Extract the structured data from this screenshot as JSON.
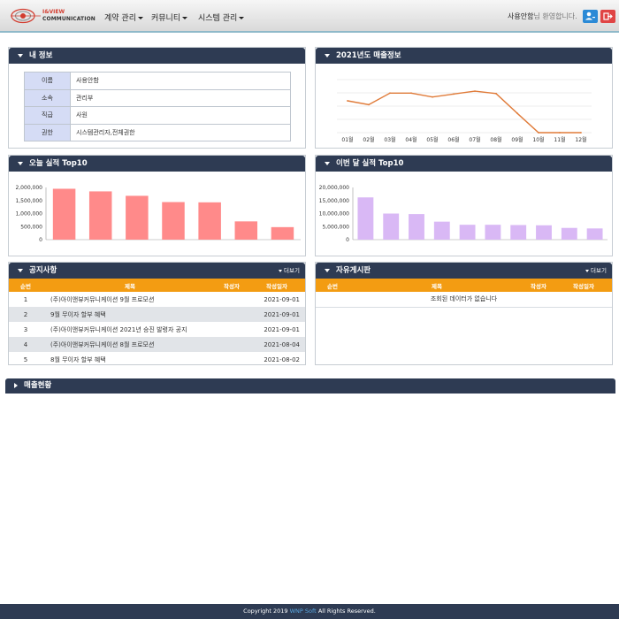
{
  "header": {
    "logo_line1": "I&VIEW",
    "logo_line2": "COMMUNICATION",
    "menus": [
      "계약 관리",
      "커뮤니티",
      "시스템 관리"
    ],
    "user_name": "사용안함",
    "greeting_suffix": "님 환영합니다."
  },
  "my_info": {
    "title": "내 정보",
    "rows": [
      {
        "key": "이름",
        "value": "사용안함"
      },
      {
        "key": "소속",
        "value": "관리부"
      },
      {
        "key": "직급",
        "value": "사원"
      },
      {
        "key": "권한",
        "value": "시스템관리자,전체권한"
      }
    ]
  },
  "sales_panel": {
    "title": "2021년도 매출정보"
  },
  "today_panel": {
    "title": "오늘 실적 Top10"
  },
  "month_panel": {
    "title": "이번 달 실적 Top10"
  },
  "notice": {
    "title": "공지사항",
    "more": "더보기",
    "columns": [
      "순번",
      "제목",
      "작성자",
      "작성일자"
    ],
    "rows": [
      {
        "no": "1",
        "title": "(주)아이앤뷰커뮤니케이션 9월 프로모션",
        "author": "",
        "date": "2021-09-01"
      },
      {
        "no": "2",
        "title": "9월 무이자 할부 혜택",
        "author": "",
        "date": "2021-09-01"
      },
      {
        "no": "3",
        "title": "(주)아이앤뷰커뮤니케이션 2021년 승진 발령자 공지",
        "author": "",
        "date": "2021-09-01"
      },
      {
        "no": "4",
        "title": "(주)아이앤뷰커뮤니케이션 8월 프로모션",
        "author": "",
        "date": "2021-08-04"
      },
      {
        "no": "5",
        "title": "8월 무이자 할부 혜택",
        "author": "",
        "date": "2021-08-02"
      }
    ]
  },
  "free_board": {
    "title": "자유게시판",
    "more": "더보기",
    "columns": [
      "순번",
      "제목",
      "작성자",
      "작성일자"
    ],
    "empty_text": "조회된 데이터가 없습니다"
  },
  "sales_status": {
    "title": "매출현황"
  },
  "footer": {
    "copyright": "Copyright 2019",
    "brand": "WNP Soft",
    "rights": "All Rights Reserved."
  },
  "colors": {
    "nav": "#2e3b53",
    "line": "#e07b39",
    "today_bar": "#ff8a8a",
    "month_bar": "#d9b8f5",
    "board_head": "#f39c12",
    "info_key": "#d5dcf5"
  },
  "chart_data": [
    {
      "type": "line",
      "categories": [
        "01월",
        "02월",
        "03월",
        "04월",
        "05월",
        "06월",
        "07월",
        "08월",
        "09월",
        "10월",
        "11월",
        "12월"
      ],
      "values": [
        0.66,
        0.58,
        0.82,
        0.82,
        0.74,
        0.8,
        0.86,
        0.81,
        0.4,
        0,
        0,
        0
      ],
      "ylim": [
        0,
        1.1
      ],
      "grid": true
    },
    {
      "type": "bar",
      "values": [
        1950000,
        1850000,
        1680000,
        1440000,
        1430000,
        700000,
        480000
      ],
      "yticks": [
        "2,000,000",
        "1,500,000",
        "1,000,000",
        "500,000",
        "0"
      ],
      "ylim": [
        0,
        2000000
      ]
    },
    {
      "type": "bar",
      "values": [
        16200000,
        10000000,
        9800000,
        6900000,
        5700000,
        5700000,
        5600000,
        5500000,
        4500000,
        4300000
      ],
      "yticks": [
        "20,000,000",
        "15,000,000",
        "10,000,000",
        "5,000,000",
        "0"
      ],
      "ylim": [
        0,
        20000000
      ]
    }
  ]
}
